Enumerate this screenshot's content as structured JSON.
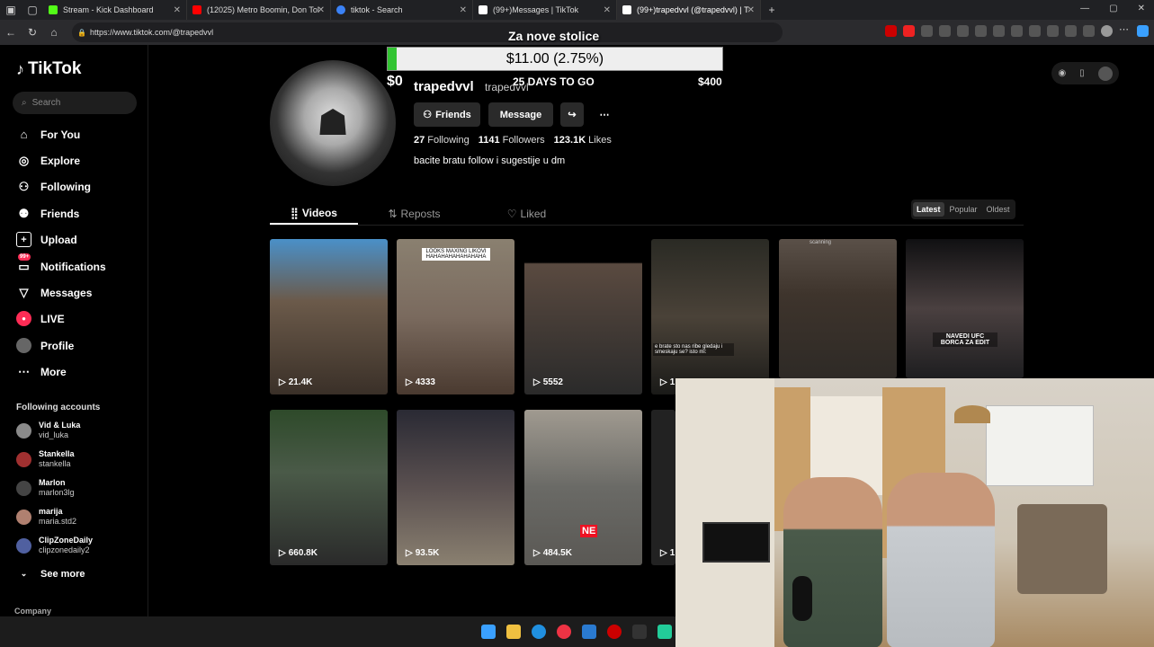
{
  "browser": {
    "tabs": [
      {
        "title": "Stream - Kick Dashboard",
        "color": "#53fc18"
      },
      {
        "title": "(12025) Metro Boomin, Don Toliv…",
        "color": "#ff0000"
      },
      {
        "title": "tiktok - Search",
        "color": "#3b82f6"
      },
      {
        "title": "(99+)Messages | TikTok",
        "color": "#ffffff"
      },
      {
        "title": "(99+)trapedvvl (@trapedvvl) | Tik",
        "color": "#ffffff"
      }
    ],
    "url": "https://www.tiktok.com/@trapedvvl"
  },
  "sidebar": {
    "logo": "TikTok",
    "search_placeholder": "Search",
    "nav": [
      {
        "label": "For You",
        "icon": "home-icon"
      },
      {
        "label": "Explore",
        "icon": "compass-icon"
      },
      {
        "label": "Following",
        "icon": "following-icon"
      },
      {
        "label": "Friends",
        "icon": "friends-icon"
      },
      {
        "label": "Upload",
        "icon": "upload-icon"
      },
      {
        "label": "Notifications",
        "icon": "notifications-icon",
        "badge": "99+"
      },
      {
        "label": "Messages",
        "icon": "messages-icon"
      },
      {
        "label": "LIVE",
        "icon": "live-icon"
      },
      {
        "label": "Profile",
        "icon": "profile-icon"
      },
      {
        "label": "More",
        "icon": "more-icon"
      }
    ],
    "following_title": "Following accounts",
    "following": [
      {
        "name": "Vid & Luka",
        "handle": "vid_luka"
      },
      {
        "name": "Stankella",
        "handle": "stankella"
      },
      {
        "name": "Marlon",
        "handle": "marlon3lg"
      },
      {
        "name": "marija",
        "handle": "maria.std2"
      },
      {
        "name": "ClipZoneDaily",
        "handle": "clipzonedaily2"
      }
    ],
    "see_more": "See more",
    "company": "Company"
  },
  "profile": {
    "username": "trapedvvl",
    "nickname": "trapedvvl",
    "friends_btn": "Friends",
    "message_btn": "Message",
    "following_count": "27",
    "following_label": "Following",
    "followers_count": "1141",
    "followers_label": "Followers",
    "likes_count": "123.1K",
    "likes_label": "Likes",
    "bio": "bacite bratu follow i sugestije u dm",
    "tabs": [
      "Videos",
      "Reposts",
      "Liked"
    ],
    "sort": [
      "Latest",
      "Popular",
      "Oldest"
    ]
  },
  "videos": [
    {
      "views": "21.4K",
      "color": "#6b5a4a"
    },
    {
      "views": "4333",
      "color": "#7a6a5e",
      "caption": "LOOKS MAXING LIKOVI HAHAHAHAHAHAHAHA"
    },
    {
      "views": "5552",
      "color": "#2a2a2a"
    },
    {
      "views": "1",
      "color": "#3a3a36",
      "caption": "e brate sto nas ribe gledaju i smeskaju se? isto mi:"
    },
    {
      "views": "",
      "color": "#2e2a26",
      "caption": "scanning"
    },
    {
      "views": "",
      "color": "#1e1e20",
      "caption": "NAVEDI UFC BORCA ZA EDIT"
    },
    {
      "views": "660.8K",
      "color": "#4a5a48"
    },
    {
      "views": "93.5K",
      "color": "#5a5050"
    },
    {
      "views": "484.5K",
      "color": "#6a6a66",
      "caption": "NE"
    },
    {
      "views": "1",
      "color": "#222222"
    }
  ],
  "stream_overlay": {
    "title": "Za nove stolice",
    "goal_text": "$11.00 (2.75%)",
    "goal_progress_pct": 2.75,
    "start": "$0",
    "days": "25 DAYS TO GO",
    "target": "$400"
  }
}
